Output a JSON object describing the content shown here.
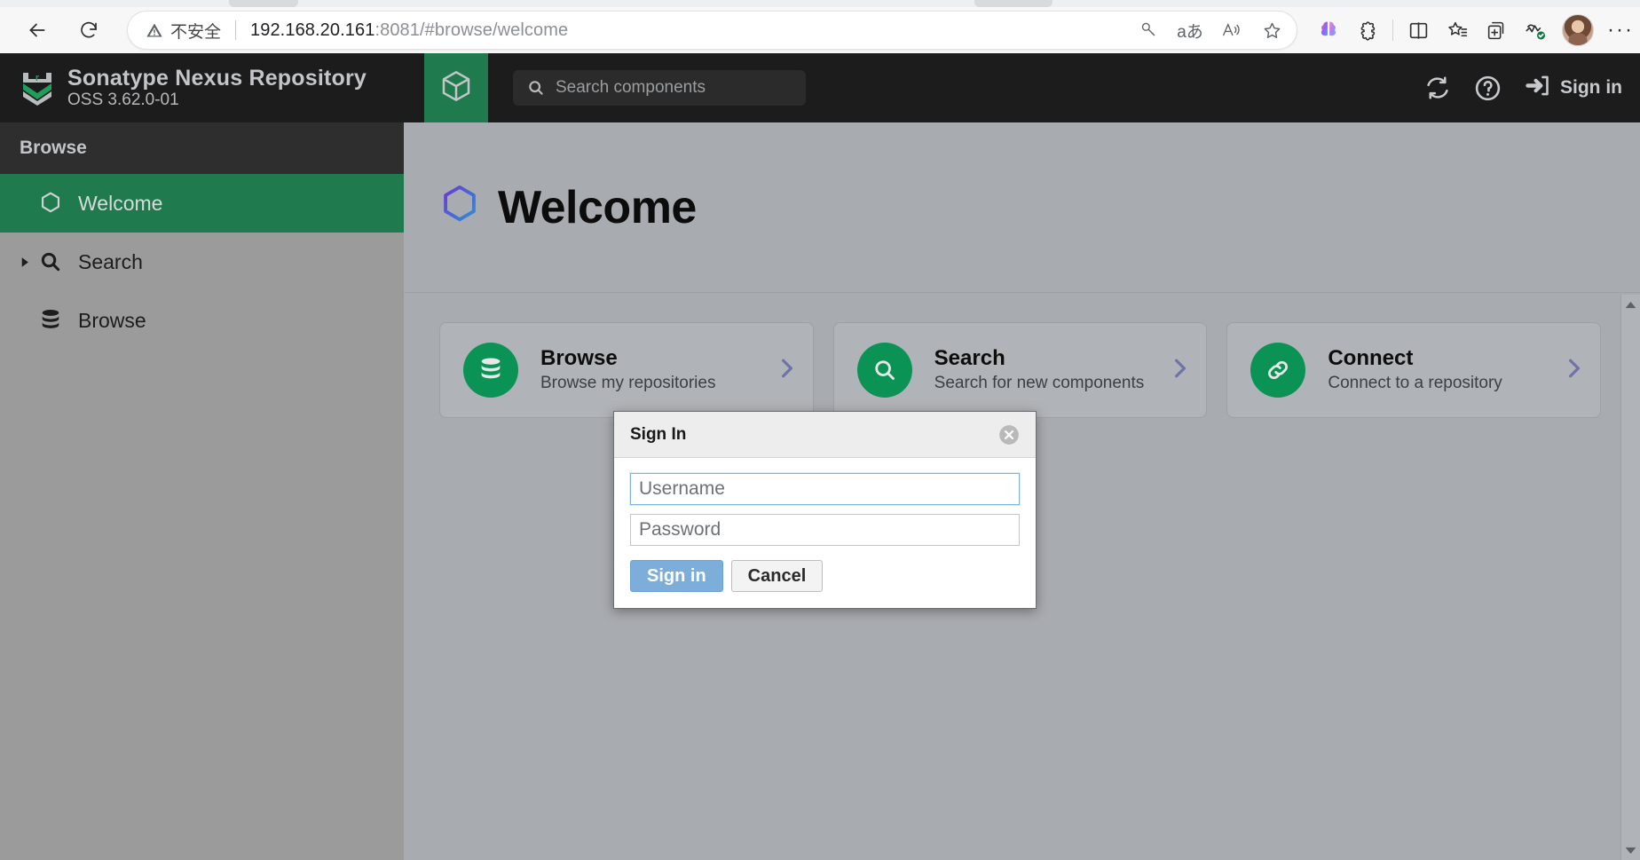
{
  "browser": {
    "back_icon": "back-arrow-icon",
    "reload_icon": "reload-icon",
    "security_label": "不安全",
    "url_host": "192.168.20.161",
    "url_path": ":8081/#browse/welcome",
    "omnibox_icons": [
      "key-icon",
      "translate-icon",
      "read-aloud-icon",
      "favorite-star-icon"
    ],
    "translate_label": "aあ",
    "toolbar_icons": [
      "copilot-icon",
      "extensions-icon",
      "split-screen-icon",
      "favorites-icon",
      "collections-icon",
      "browser-essentials-icon",
      "profile-avatar",
      "settings-more-icon"
    ],
    "more_label": "···"
  },
  "app": {
    "brand": {
      "title": "Sonatype Nexus Repository",
      "version": "OSS 3.62.0-01",
      "logo_icon": "nexus-chevron-logo"
    },
    "tab_icon": "cube-icon",
    "search": {
      "placeholder": "Search components",
      "icon": "search-icon",
      "value": ""
    },
    "actions": {
      "refresh_icon": "refresh-icon",
      "help_icon": "help-circle-icon",
      "signin_icon": "sign-in-arrow-icon",
      "signin_label": "Sign in"
    },
    "sidebar": {
      "header": "Browse",
      "items": [
        {
          "label": "Welcome",
          "icon": "hexagon-icon",
          "active": true,
          "expandable": false
        },
        {
          "label": "Search",
          "icon": "search-icon",
          "active": false,
          "expandable": true
        },
        {
          "label": "Browse",
          "icon": "database-icon",
          "active": false,
          "expandable": false
        }
      ]
    },
    "page": {
      "title": "Welcome",
      "title_icon": "hexagon-gradient-icon",
      "cards": [
        {
          "title": "Browse",
          "subtitle": "Browse my repositories",
          "icon": "database-icon",
          "chevron": "chevron-right-icon"
        },
        {
          "title": "Search",
          "subtitle": "Search for new components",
          "icon": "search-icon",
          "chevron": "chevron-right-icon"
        },
        {
          "title": "Connect",
          "subtitle": "Connect to a repository",
          "icon": "link-icon",
          "chevron": "chevron-right-icon"
        }
      ]
    },
    "scrollbar": {
      "up_icon": "scroll-up-arrow",
      "down_icon": "scroll-down-arrow"
    }
  },
  "dialog": {
    "title": "Sign In",
    "close_icon": "close-circle-icon",
    "username": {
      "value": "",
      "placeholder": "Username"
    },
    "password": {
      "value": "",
      "placeholder": "Password"
    },
    "submit_label": "Sign in",
    "cancel_label": "Cancel"
  },
  "colors": {
    "nexus_green": "#1f7a4d",
    "card_icon_green": "#0a9355",
    "topbar_dark": "#1c1c1c",
    "sidebar_gray": "#9b9b9b",
    "content_gray": "#a8abb0",
    "primary_button": "#7daeda",
    "chevron_purple": "#6f74a8"
  }
}
